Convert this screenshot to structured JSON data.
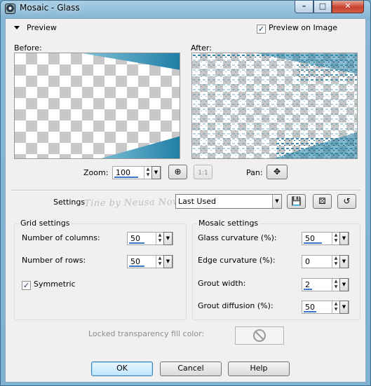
{
  "window": {
    "title": "Mosaic - Glass",
    "min": "–",
    "max": "□",
    "close": "✕"
  },
  "preview": {
    "toggle_label": "Preview",
    "on_image_label": "Preview on Image",
    "on_image_checked": true
  },
  "panes": {
    "before_label": "Before:",
    "after_label": "After:"
  },
  "zoom": {
    "label": "Zoom:",
    "value": "100",
    "pan_label": "Pan:"
  },
  "settings": {
    "label": "Settings",
    "value": "Last Used",
    "watermark": "Tine by Neusa Novaes"
  },
  "grid": {
    "title": "Grid settings",
    "columns_label": "Number of columns:",
    "columns_value": "50",
    "rows_label": "Number of rows:",
    "rows_value": "50",
    "symmetric_label": "Symmetric",
    "symmetric_checked": true
  },
  "mosaic": {
    "title": "Mosaic settings",
    "glass_label": "Glass curvature (%):",
    "glass_value": "50",
    "edge_label": "Edge curvature (%):",
    "edge_value": "0",
    "grout_width_label": "Grout width:",
    "grout_width_value": "2",
    "grout_diffusion_label": "Grout diffusion (%):",
    "grout_diffusion_value": "50"
  },
  "locked": {
    "label": "Locked transparency fill color:"
  },
  "buttons": {
    "ok": "OK",
    "cancel": "Cancel",
    "help": "Help"
  },
  "colors": {
    "accent": "#3a78c8",
    "teal": "#2f87a9",
    "frame": "#7eb1d2"
  }
}
